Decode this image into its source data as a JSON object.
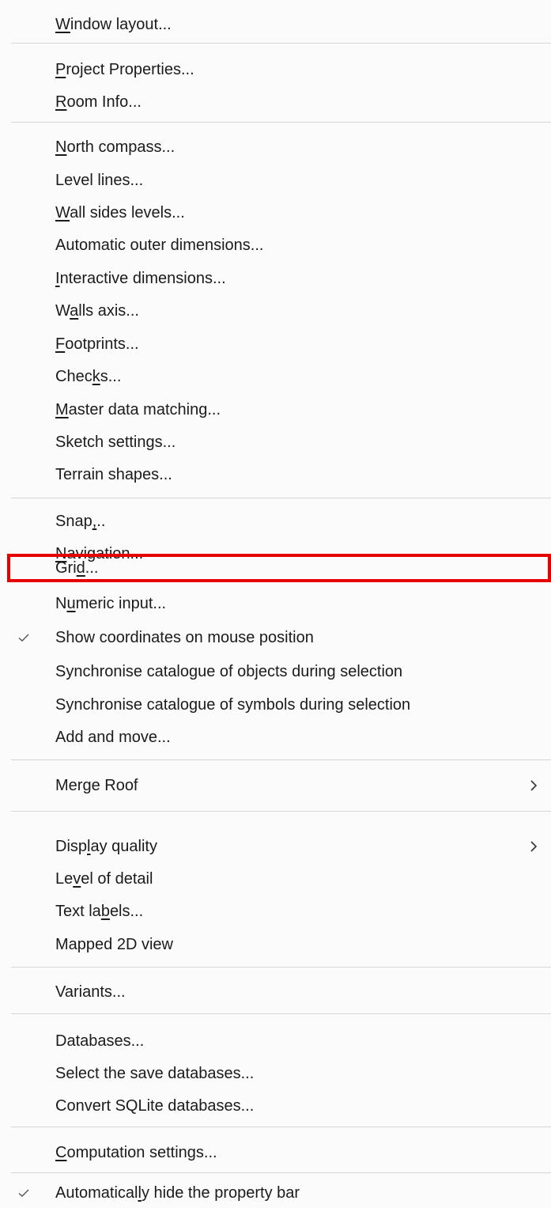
{
  "menu": {
    "items": [
      {
        "pre": "",
        "u": "W",
        "post": "indow layout..."
      },
      {
        "pre": "",
        "u": "P",
        "post": "roject Properties..."
      },
      {
        "pre": "",
        "u": "R",
        "post": "oom Info..."
      },
      {
        "pre": "",
        "u": "N",
        "post": "orth compass..."
      },
      {
        "pre": "Level lines...",
        "u": "",
        "post": ""
      },
      {
        "pre": "",
        "u": "W",
        "post": "all sides levels..."
      },
      {
        "pre": "Automatic outer dimensions...",
        "u": "",
        "post": ""
      },
      {
        "pre": "",
        "u": "I",
        "post": "nteractive dimensions..."
      },
      {
        "pre": "W",
        "u": "a",
        "post": "lls axis..."
      },
      {
        "pre": "",
        "u": "F",
        "post": "ootprints..."
      },
      {
        "pre": "Chec",
        "u": "k",
        "post": "s..."
      },
      {
        "pre": "",
        "u": "M",
        "post": "aster data matching..."
      },
      {
        "pre": "Sketch settings...",
        "u": "",
        "post": ""
      },
      {
        "pre": "Terrain shapes...",
        "u": "",
        "post": ""
      },
      {
        "pre": "Snap",
        "u": ",",
        "post": ".."
      },
      {
        "pre": "",
        "u": "N",
        "post": "avigation..."
      },
      {
        "pre": "Gri",
        "u": "d",
        "post": "..."
      },
      {
        "pre": "N",
        "u": "u",
        "post": "meric input..."
      },
      {
        "pre": "Show coordinates on mouse position",
        "u": "",
        "post": "",
        "checked": true
      },
      {
        "pre": "Synchronise catalogue of objects during selection",
        "u": "",
        "post": ""
      },
      {
        "pre": "Synchronise catalogue of symbols during selection",
        "u": "",
        "post": ""
      },
      {
        "pre": "Add and move...",
        "u": "",
        "post": ""
      },
      {
        "pre": "Merge Roof",
        "u": "",
        "post": "",
        "submenu": true
      },
      {
        "pre": "Disp",
        "u": "l",
        "post": "ay quality",
        "submenu": true
      },
      {
        "pre": "Le",
        "u": "v",
        "post": "el of detail"
      },
      {
        "pre": "Text la",
        "u": "b",
        "post": "els..."
      },
      {
        "pre": "Mapped 2D view",
        "u": "",
        "post": ""
      },
      {
        "pre": "Variants...",
        "u": "",
        "post": ""
      },
      {
        "pre": "Databases...",
        "u": "",
        "post": ""
      },
      {
        "pre": "Select the save databases...",
        "u": "",
        "post": ""
      },
      {
        "pre": "Convert SQLite databases...",
        "u": "",
        "post": ""
      },
      {
        "pre": "",
        "u": "C",
        "post": "omputation settings..."
      },
      {
        "pre": "Automatical",
        "u": "l",
        "post": "y hide the property bar",
        "checked": true
      }
    ]
  },
  "icons": {
    "check": "checkmark-icon",
    "submenu": "chevron-right-icon"
  },
  "colors": {
    "highlight_box": "#e60000",
    "separator": "#d6d6d6",
    "text": "#1b1b1b",
    "background": "#fbfbfb"
  }
}
